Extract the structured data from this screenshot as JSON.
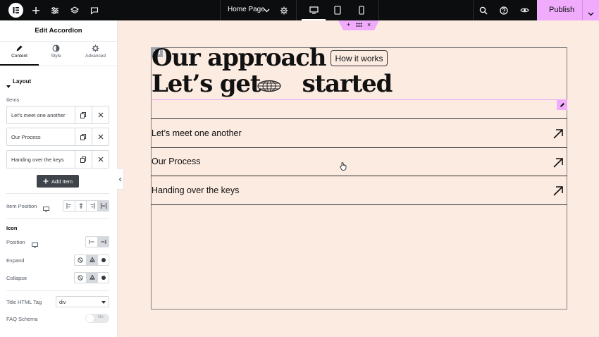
{
  "topbar": {
    "page_title": "Home Page",
    "publish_label": "Publish",
    "colors": {
      "bar": "#0c0d0e",
      "publish": "#f0abfc"
    },
    "icons": [
      "elementor-logo-icon",
      "add-icon",
      "settings-sliders-icon",
      "layers-icon",
      "comments-icon",
      "chevron-down-icon",
      "gear-icon",
      "desktop-icon",
      "tablet-icon",
      "mobile-icon",
      "search-icon",
      "help-icon",
      "eye-icon"
    ]
  },
  "panel": {
    "title": "Edit Accordion",
    "tabs": [
      {
        "label": "Content",
        "icon": "pencil-icon"
      },
      {
        "label": "Style",
        "icon": "contrast-icon"
      },
      {
        "label": "Advanced",
        "icon": "gear-icon"
      }
    ],
    "layout_section": "Layout",
    "items_label": "Items",
    "items": [
      {
        "label": "Let's meet one another"
      },
      {
        "label": "Our Process"
      },
      {
        "label": "Handing over the keys"
      }
    ],
    "add_item_label": "Add Item",
    "item_position_label": "Item Position",
    "icon_section": "Icon",
    "position_label": "Position",
    "expand_label": "Expand",
    "collapse_label": "Collapse",
    "title_html_tag_label": "Title HTML Tag",
    "title_html_tag_value": "div",
    "faq_schema_label": "FAQ Schema",
    "faq_schema_toggle": "No"
  },
  "canvas": {
    "heading_line1": "Our approach",
    "heading_line2_a": "Let’s get",
    "heading_line2_b": "started",
    "chip_label": "How it works",
    "accordion_items": [
      {
        "title": "Let’s meet one another"
      },
      {
        "title": "Our Process"
      },
      {
        "title": "Handing over the keys"
      }
    ],
    "colors": {
      "background": "#fcebe1",
      "accent": "#f0abfc"
    }
  }
}
